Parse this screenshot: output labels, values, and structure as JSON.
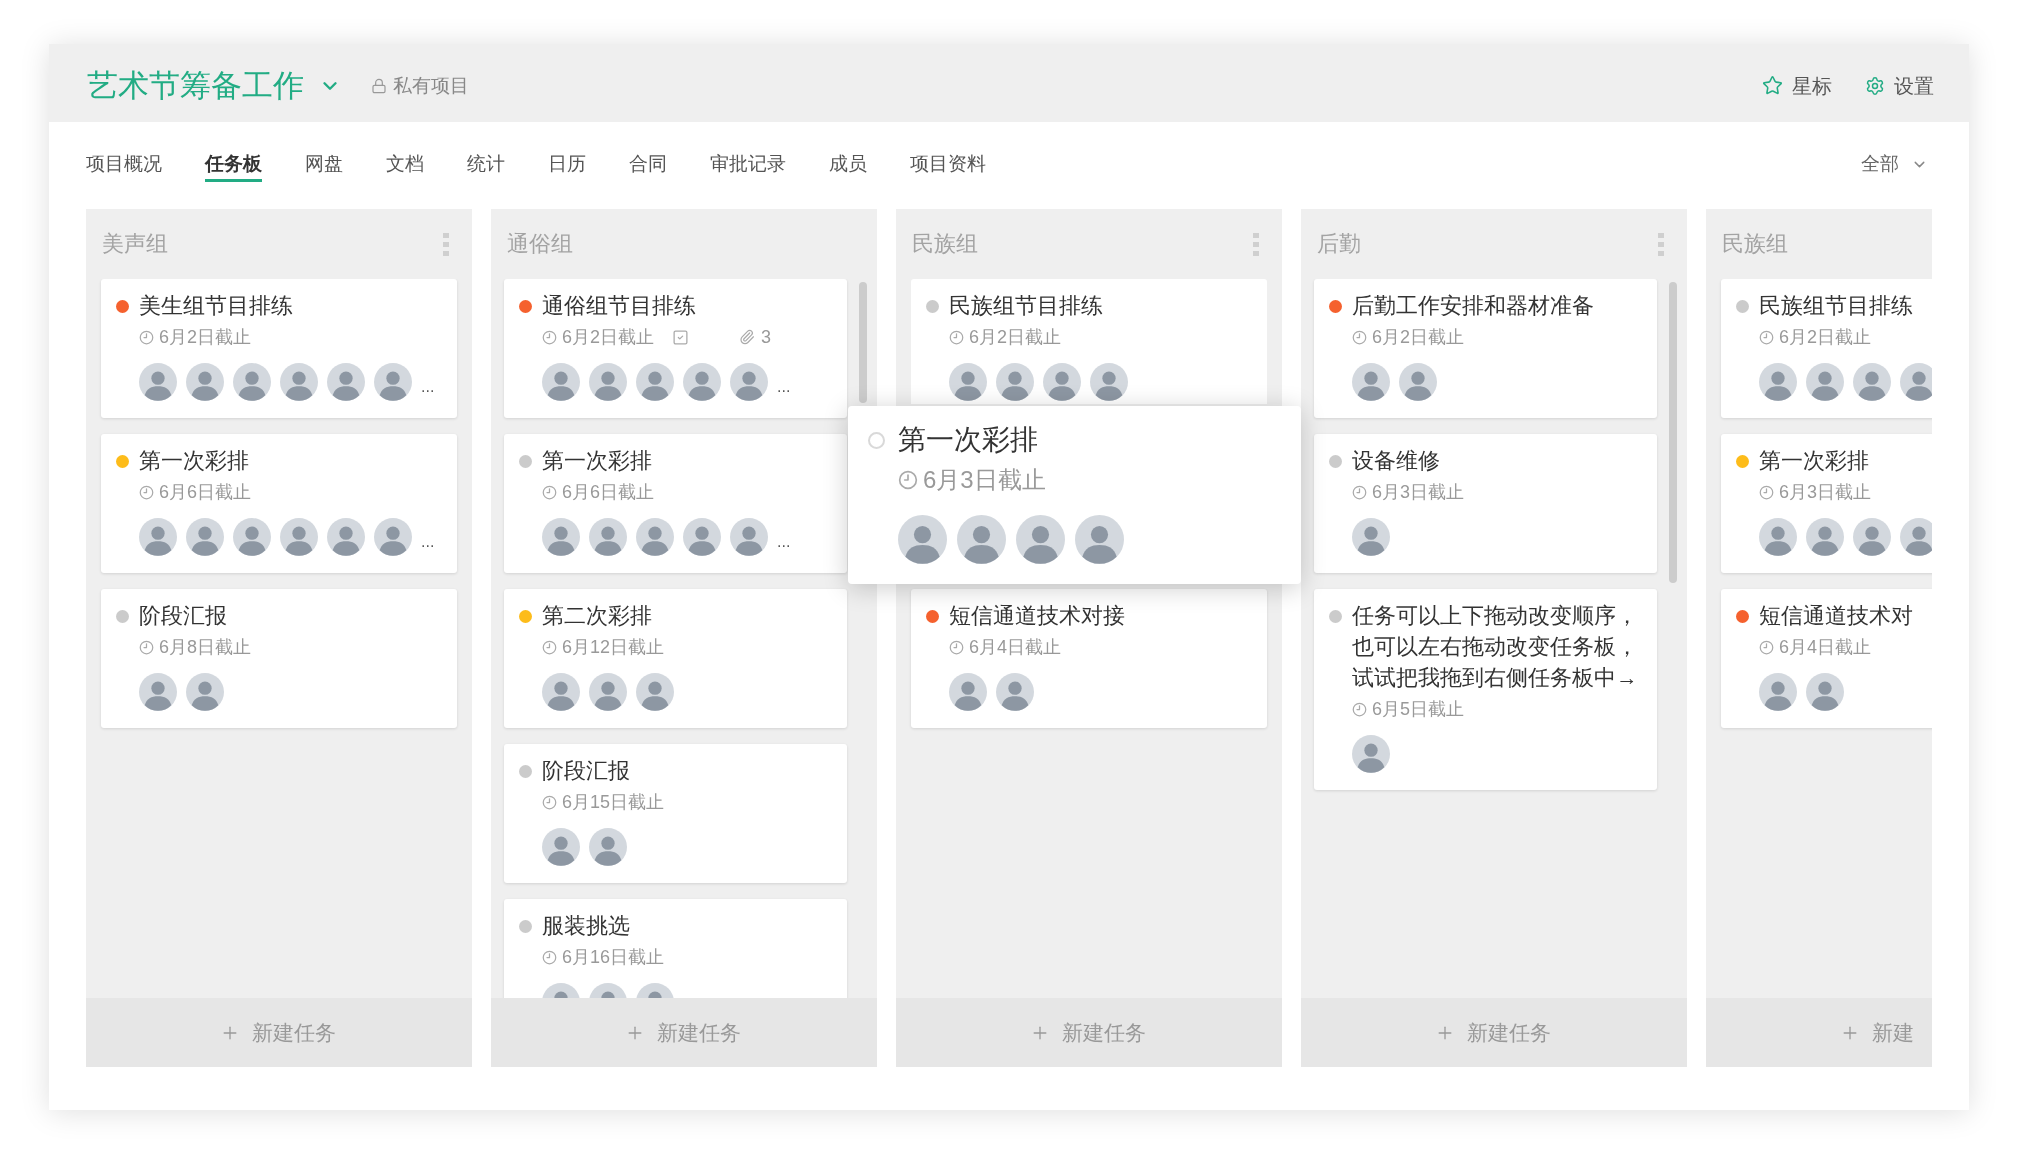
{
  "project": {
    "title": "艺术节筹备工作",
    "visibility": "私有项目"
  },
  "header_actions": [
    {
      "kind": "star",
      "label": "星标"
    },
    {
      "kind": "settings",
      "label": "设置"
    }
  ],
  "tabs": [
    {
      "label": "项目概况",
      "selected": false
    },
    {
      "label": "任务板",
      "selected": true
    },
    {
      "label": "网盘",
      "selected": false
    },
    {
      "label": "文档",
      "selected": false
    },
    {
      "label": "统计",
      "selected": false
    },
    {
      "label": "日历",
      "selected": false
    },
    {
      "label": "合同",
      "selected": false
    },
    {
      "label": "审批记录",
      "selected": false
    },
    {
      "label": "成员",
      "selected": false
    },
    {
      "label": "项目资料",
      "selected": false
    }
  ],
  "filter": {
    "label": "全部"
  },
  "columns": [
    {
      "title": "美声组",
      "menu_icon": true,
      "scrollable": false,
      "new_task_label": "新建任务",
      "cards": [
        {
          "kind": "task",
          "title": "美生组节目排练",
          "color": "#f5612e",
          "due": "6月2日截止",
          "avatars": [
            {
              "kind": "photo"
            },
            {
              "kind": "photo"
            },
            {
              "kind": "photo"
            },
            {
              "kind": "photo"
            },
            {
              "kind": "photo"
            },
            {
              "kind": "photo"
            }
          ],
          "more": "..."
        },
        {
          "kind": "task",
          "title": "第一次彩排",
          "color": "#fdbc1a",
          "due": "6月6日截止",
          "avatars": [
            {
              "kind": "photo"
            },
            {
              "kind": "photo"
            },
            {
              "kind": "photo"
            },
            {
              "kind": "photo"
            },
            {
              "kind": "photo"
            },
            {
              "kind": "photo"
            }
          ],
          "more": "..."
        },
        {
          "kind": "task",
          "title": "阶段汇报",
          "color": "#cbcbcb",
          "due": "6月8日截止",
          "avatars": [
            {
              "kind": "photo"
            },
            {
              "kind": "photo"
            }
          ]
        }
      ]
    },
    {
      "title": "通俗组",
      "menu_icon": false,
      "scrollable": true,
      "new_task_label": "新建任务",
      "cards": [
        {
          "kind": "task",
          "title": "通俗组节目排练",
          "color": "#f5612e",
          "due": "6月2日截止",
          "badges": [
            {
              "kind": "checklist"
            },
            {
              "kind": "attachment",
              "count": "3"
            }
          ],
          "avatars": [
            {
              "kind": "photo"
            },
            {
              "kind": "photo"
            },
            {
              "kind": "photo"
            },
            {
              "kind": "photo"
            },
            {
              "kind": "photo"
            }
          ],
          "more": "..."
        },
        {
          "kind": "task",
          "title": "第一次彩排",
          "color": "#cbcbcb",
          "due": "6月6日截止",
          "avatars": [
            {
              "kind": "photo"
            },
            {
              "kind": "photo"
            },
            {
              "kind": "photo"
            },
            {
              "kind": "photo"
            },
            {
              "kind": "photo"
            }
          ],
          "more": "..."
        },
        {
          "kind": "task",
          "title": "第二次彩排",
          "color": "#fdbc1a",
          "due": "6月12日截止",
          "avatars": [
            {
              "kind": "photo"
            },
            {
              "kind": "photo"
            },
            {
              "kind": "photo"
            }
          ]
        },
        {
          "kind": "task",
          "title": "阶段汇报",
          "color": "#cbcbcb",
          "due": "6月15日截止",
          "avatars": [
            {
              "kind": "photo"
            },
            {
              "kind": "photo"
            }
          ]
        },
        {
          "kind": "task",
          "title": "服装挑选",
          "color": "#cbcbcb",
          "due": "6月16日截止",
          "avatars": [
            {
              "kind": "photo"
            },
            {
              "kind": "photo"
            },
            {
              "kind": "photo"
            }
          ]
        }
      ]
    },
    {
      "title": "民族组",
      "menu_icon": true,
      "scrollable": false,
      "new_task_label": "新建任务",
      "cards": [
        {
          "kind": "task",
          "title": "民族组节目排练",
          "color": "#cbcbcb",
          "due": "6月2日截止",
          "avatars": [
            {
              "kind": "photo"
            },
            {
              "kind": "photo"
            },
            {
              "kind": "photo"
            },
            {
              "kind": "photo"
            }
          ]
        },
        {
          "kind": "dragging",
          "title": "第一次彩排",
          "color": "#d9d9d9",
          "due": "6月3日截止",
          "avatars": [
            {
              "kind": "photo"
            },
            {
              "kind": "photo"
            },
            {
              "kind": "photo"
            },
            {
              "kind": "photo"
            }
          ]
        },
        {
          "kind": "task",
          "title": "短信通道技术对接",
          "color": "#f5612e",
          "due": "6月4日截止",
          "avatars": [
            {
              "kind": "photo"
            },
            {
              "kind": "photo"
            }
          ]
        }
      ]
    },
    {
      "title": "后勤",
      "menu_icon": true,
      "scrollable": true,
      "new_task_label": "新建任务",
      "cards": [
        {
          "kind": "task",
          "title": "后勤工作安排和器材准备",
          "color": "#f5612e",
          "due": "6月2日截止",
          "avatars": [
            {
              "kind": "photo"
            },
            {
              "kind": "photo"
            }
          ]
        },
        {
          "kind": "task",
          "title": "设备维修",
          "color": "#cbcbcb",
          "due": "6月3日截止",
          "avatars": [
            {
              "kind": "photo"
            }
          ]
        },
        {
          "kind": "task",
          "title": "任务可以上下拖动改变顺序，也可以左右拖动改变任务板，试试把我拖到右侧任务板中→",
          "color": "#cbcbcb",
          "due": "6月5日截止",
          "avatars": [
            {
              "kind": "photo"
            }
          ]
        }
      ]
    },
    {
      "title": "民族组",
      "menu_icon": false,
      "scrollable": false,
      "new_task_label": "新建",
      "cards": [
        {
          "kind": "task",
          "title": "民族组节目排练",
          "color": "#cbcbcb",
          "due": "6月2日截止",
          "avatars": [
            {
              "kind": "photo"
            },
            {
              "kind": "photo"
            },
            {
              "kind": "photo"
            },
            {
              "kind": "photo"
            }
          ]
        },
        {
          "kind": "task",
          "title": "第一次彩排",
          "color": "#fdbc1a",
          "due": "6月3日截止",
          "avatars": [
            {
              "kind": "photo"
            },
            {
              "kind": "photo"
            },
            {
              "kind": "photo"
            },
            {
              "kind": "photo"
            }
          ]
        },
        {
          "kind": "task",
          "title": "短信通道技术对",
          "color": "#f5612e",
          "due": "6月4日截止",
          "avatars": [
            {
              "kind": "photo"
            },
            {
              "kind": "photo"
            }
          ]
        }
      ]
    }
  ]
}
